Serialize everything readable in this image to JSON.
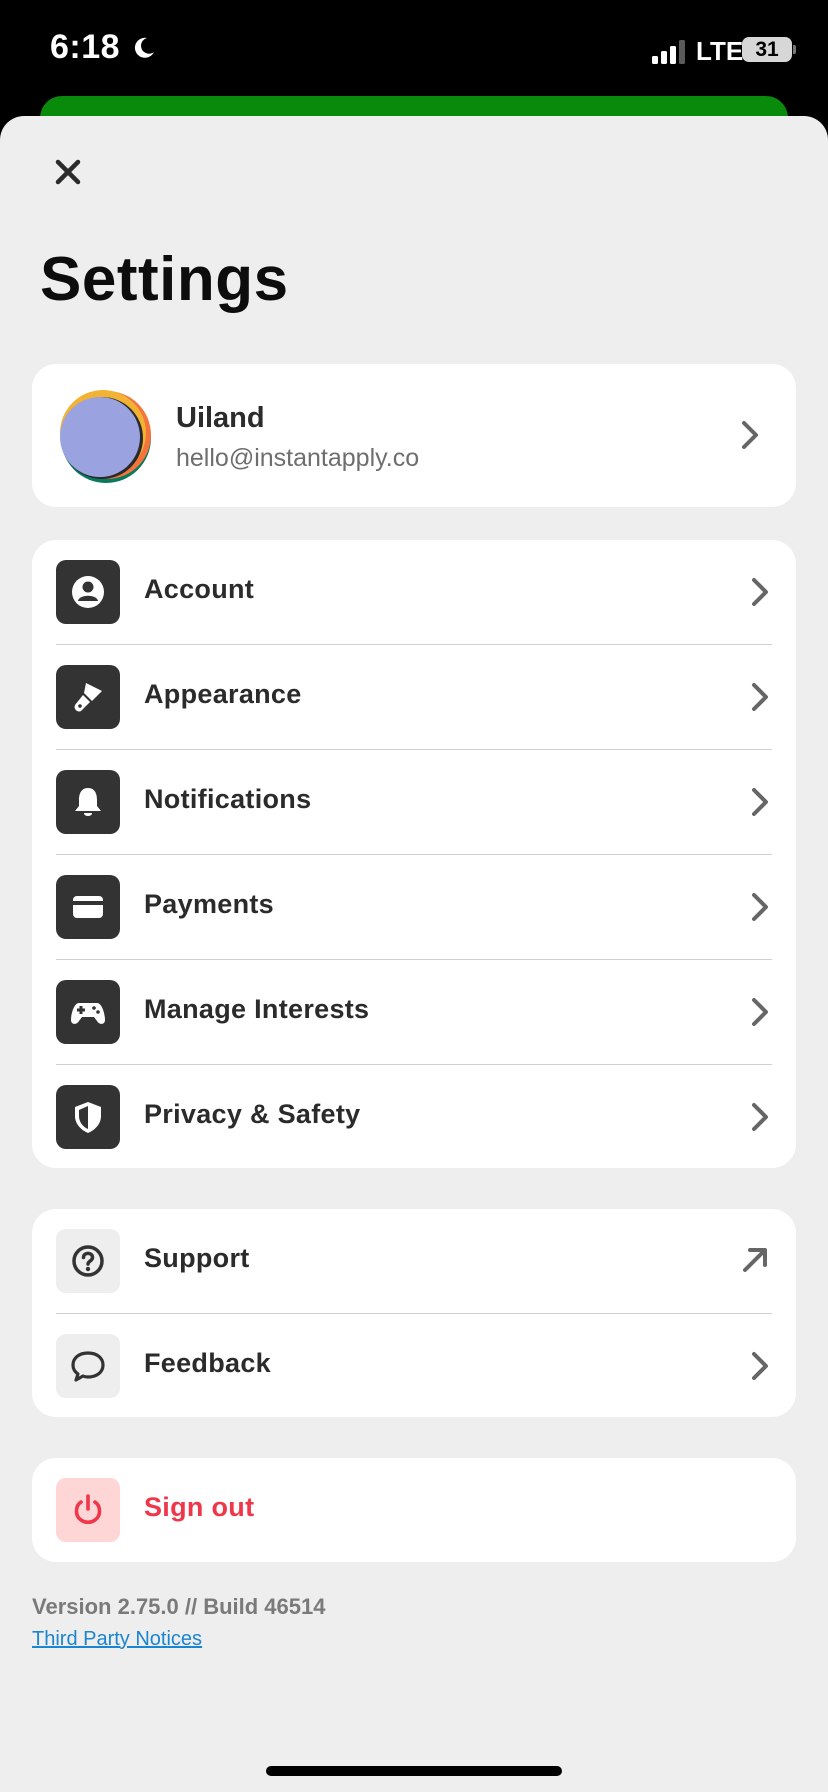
{
  "status_bar": {
    "time": "6:18",
    "network": "LTE",
    "battery": "31"
  },
  "page": {
    "title": "Settings"
  },
  "profile": {
    "name": "Uiland",
    "email": "hello@instantapply.co"
  },
  "menu": {
    "items": [
      {
        "label": "Account",
        "icon": "person-icon"
      },
      {
        "label": "Appearance",
        "icon": "paintbrush-icon"
      },
      {
        "label": "Notifications",
        "icon": "bell-icon"
      },
      {
        "label": "Payments",
        "icon": "credit-card-icon"
      },
      {
        "label": "Manage Interests",
        "icon": "gamepad-icon"
      },
      {
        "label": "Privacy & Safety",
        "icon": "shield-icon"
      }
    ]
  },
  "support": {
    "items": [
      {
        "label": "Support",
        "icon": "question-circle-icon"
      },
      {
        "label": "Feedback",
        "icon": "chat-bubble-icon"
      }
    ]
  },
  "signout": {
    "label": "Sign out",
    "icon": "power-icon"
  },
  "footer": {
    "version": "Version 2.75.0 // Build 46514",
    "notices": "Third Party Notices"
  },
  "colors": {
    "accent_red": "#f0374a",
    "link_blue": "#1a86d0",
    "sheet_bg": "#eeeeee",
    "icon_bg": "#333333",
    "top_green": "#0a8a0a"
  }
}
